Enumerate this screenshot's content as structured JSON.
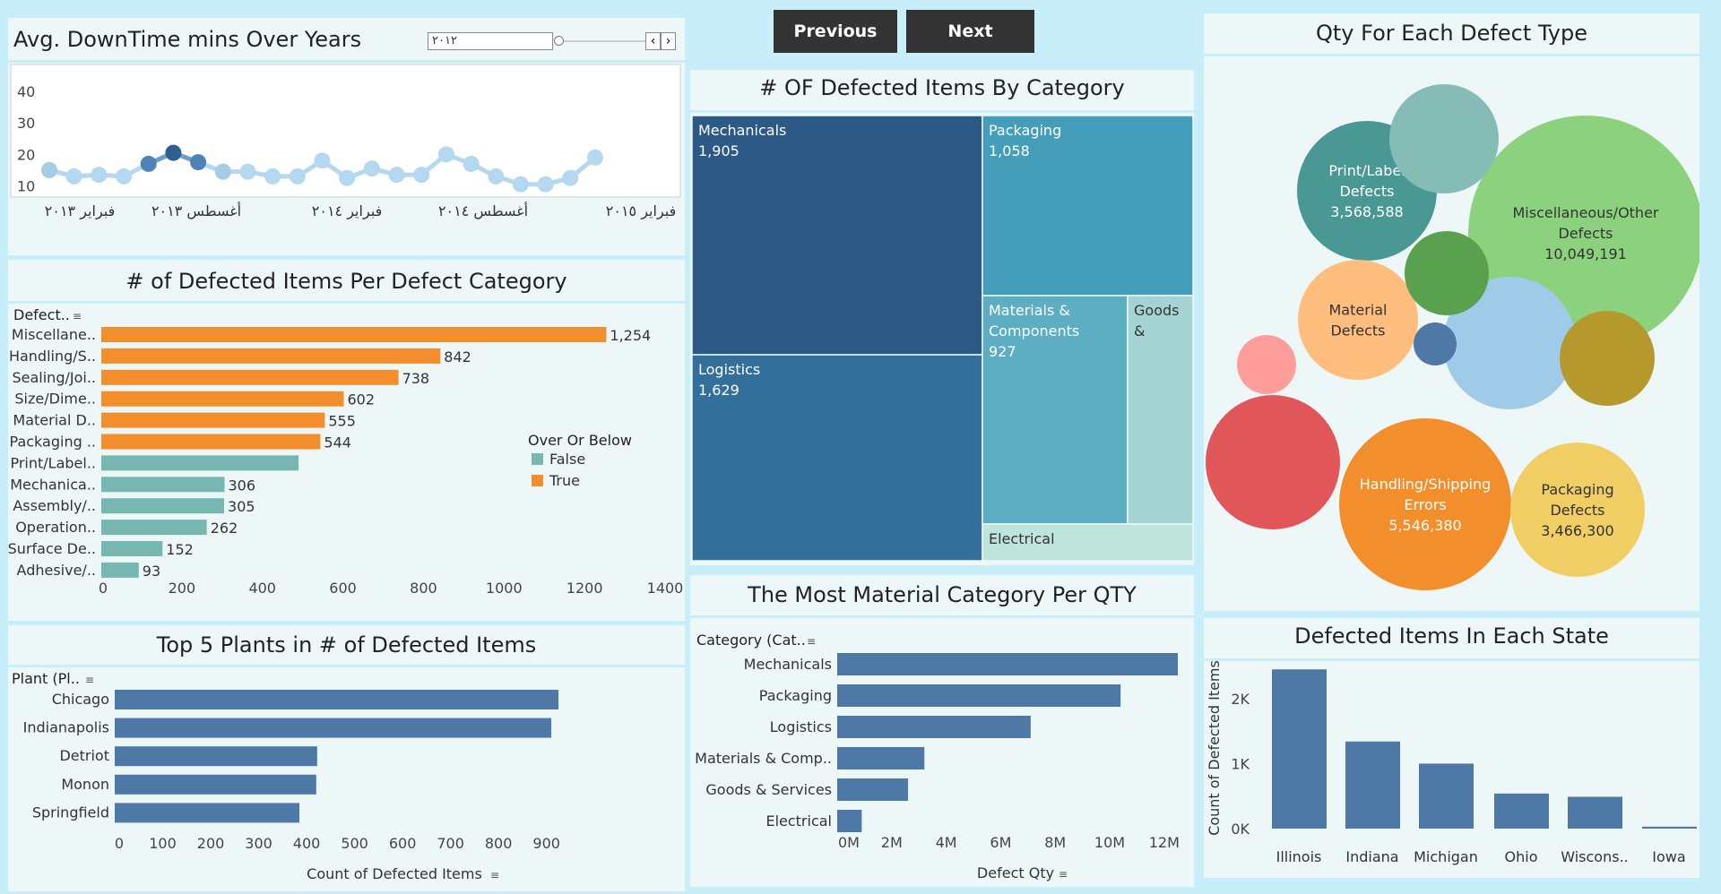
{
  "nav": {
    "previous": "Previous",
    "next": "Next"
  },
  "downtime": {
    "title": "Avg. DownTime mins Over Years",
    "slider_value": "٢٠١٢",
    "slider_prev": "‹",
    "slider_next": "›"
  },
  "chart_data": [
    {
      "id": "downtime",
      "type": "line",
      "title": "Avg. DownTime mins Over Years",
      "ylim": [
        7,
        48
      ],
      "yticks": [
        10,
        20,
        30,
        40
      ],
      "x_ticks": [
        "فبراير ٢٠١٣",
        "أغسطس ٢٠١٣",
        "فبراير ٢٠١٤",
        "أغسطس ٢٠١٤",
        "فبراير ٢٠١٥"
      ],
      "values": [
        15,
        13,
        13.5,
        13,
        17,
        20.5,
        17.5,
        14.5,
        14.5,
        13,
        13,
        18,
        12.5,
        15.5,
        13.5,
        13.5,
        20,
        17,
        13,
        10.5,
        10.5,
        12.5,
        19
      ],
      "highlight_indices": [
        4,
        5,
        6
      ]
    },
    {
      "id": "per_defect_category",
      "type": "bar",
      "orientation": "horizontal",
      "title": "# of Defected Items Per Defect Category",
      "column_header": "Defect..",
      "categories": [
        "Miscellane..",
        "Handling/S..",
        "Sealing/Joi..",
        "Size/Dime..",
        "Material D..",
        "Packaging ..",
        "Print/Label..",
        "Mechanica..",
        "Assembly/..",
        "Operation..",
        "Surface De..",
        "Adhesive/.."
      ],
      "values": [
        1254,
        842,
        738,
        602,
        555,
        544,
        490,
        306,
        305,
        262,
        152,
        93
      ],
      "value_labels": [
        "1,254",
        "842",
        "738",
        "602",
        "555",
        "544",
        "",
        "306",
        "305",
        "262",
        "152",
        "93"
      ],
      "over": [
        true,
        true,
        true,
        true,
        true,
        true,
        false,
        false,
        false,
        false,
        false,
        false
      ],
      "xlim": [
        0,
        1400
      ],
      "xticks": [
        "0",
        "200",
        "400",
        "600",
        "800",
        "1000",
        "1200",
        "1400"
      ],
      "legend": {
        "title": "Over Or Below",
        "items": [
          {
            "label": "False",
            "color": "#76b7b2"
          },
          {
            "label": "True",
            "color": "#f28e2b"
          }
        ]
      }
    },
    {
      "id": "top_plants",
      "type": "bar",
      "orientation": "horizontal",
      "title": "Top 5 Plants in # of Defected Items",
      "column_header": "Plant (Pl..",
      "categories": [
        "Chicago",
        "Indianapolis",
        "Detriot",
        "Monon",
        "Springfield"
      ],
      "values": [
        925,
        910,
        422,
        420,
        385
      ],
      "xlim": [
        0,
        950
      ],
      "xticks": [
        "0",
        "100",
        "200",
        "300",
        "400",
        "500",
        "600",
        "700",
        "800",
        "900"
      ],
      "xlabel": "Count of Defected Items",
      "color": "#4e79a7"
    },
    {
      "id": "treemap",
      "type": "treemap",
      "title": "# OF Defected Items By Category",
      "items": [
        {
          "label": "Mechanicals",
          "value": "1,905",
          "color": "#2c5986"
        },
        {
          "label": "Logistics",
          "value": "1,629",
          "color": "#336f9b"
        },
        {
          "label": "Packaging",
          "value": "1,058",
          "color": "#459eb9"
        },
        {
          "label": "Materials & Components",
          "label_lines": [
            "Materials &",
            "Components"
          ],
          "value": "927",
          "color": "#5eaec3"
        },
        {
          "label": "Goods &",
          "label_lines": [
            "Goods",
            "&"
          ],
          "value": "",
          "color": "#a3d4d3"
        },
        {
          "label": "Electrical",
          "value": "",
          "color": "#bfe4dc"
        }
      ]
    },
    {
      "id": "material_qty",
      "type": "bar",
      "orientation": "horizontal",
      "title": "The Most Material Category Per QTY",
      "column_header": "Category (Cat..",
      "categories": [
        "Mechanicals",
        "Packaging",
        "Logistics",
        "Materials & Comp..",
        "Goods & Services",
        "Electrical"
      ],
      "values": [
        12.5,
        10.4,
        7.1,
        3.2,
        2.6,
        0.9
      ],
      "xlim": [
        0,
        12.6
      ],
      "xticks": [
        "0M",
        "2M",
        "4M",
        "6M",
        "8M",
        "10M",
        "12M"
      ],
      "xlabel": "Defect Qty",
      "color": "#4e79a7"
    },
    {
      "id": "bubbles",
      "type": "scatter",
      "title": "Qty For Each Defect Type",
      "items": [
        {
          "label": "Miscellaneous/Other Defects",
          "lines": [
            "Miscellaneous/Other",
            "Defects"
          ],
          "value": "10,049,191",
          "color": "#8cd17d"
        },
        {
          "label": "Handling/Shipping Errors",
          "lines": [
            "Handling/Shipping",
            "Errors"
          ],
          "value": "5,546,380",
          "color": "#f28e2b"
        },
        {
          "label": "Print/Label Defects",
          "lines": [
            "Print/Label",
            "Defects"
          ],
          "value": "3,568,588",
          "color": "#499894"
        },
        {
          "label": "Packaging Defects",
          "lines": [
            "Packaging",
            "Defects"
          ],
          "value": "3,466,300",
          "color": "#f1ce63"
        },
        {
          "label": "Material Defects",
          "lines": [
            "Material",
            "Defects"
          ],
          "value": "",
          "color": "#ffbe7d"
        },
        {
          "label": "",
          "lines": [],
          "value": "",
          "color": "#e15759"
        },
        {
          "label": "",
          "lines": [],
          "value": "",
          "color": "#86bcb6"
        },
        {
          "label": "",
          "lines": [],
          "value": "",
          "color": "#a0cbe8"
        },
        {
          "label": "",
          "lines": [],
          "value": "",
          "color": "#b6992d"
        },
        {
          "label": "",
          "lines": [],
          "value": "",
          "color": "#59a14f"
        },
        {
          "label": "",
          "lines": [],
          "value": "",
          "color": "#ff9d9a"
        },
        {
          "label": "",
          "lines": [],
          "value": "",
          "color": "#4e79a7"
        }
      ]
    },
    {
      "id": "states",
      "type": "bar",
      "orientation": "vertical",
      "title": "Defected Items In Each State",
      "categories": [
        "Illinois",
        "Indiana",
        "Michigan",
        "Ohio",
        "Wiscons..",
        "Iowa"
      ],
      "values": [
        2450,
        1340,
        1000,
        540,
        490,
        30
      ],
      "ylim": [
        0,
        2550
      ],
      "yticks": [
        {
          "v": 0,
          "label": "0K"
        },
        {
          "v": 1000,
          "label": "1K"
        },
        {
          "v": 2000,
          "label": "2K"
        }
      ],
      "ylabel": "Count of Defected Items",
      "color": "#4e79a7"
    }
  ]
}
